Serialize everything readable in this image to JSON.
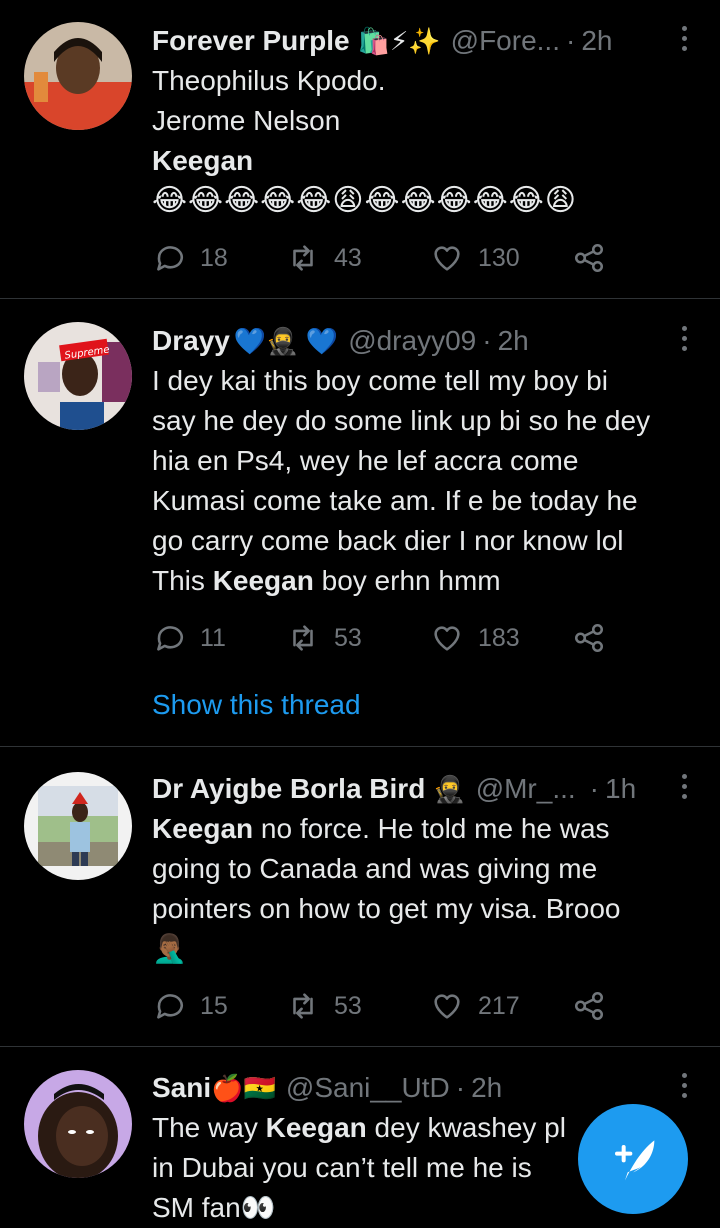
{
  "tweets": [
    {
      "name": "Forever Purple",
      "name_emojis": "🛍️⚡✨",
      "handle": "@Fore...",
      "time": "2h",
      "text_lines": [
        "Theophilus Kpodo.",
        "Jerome Nelson"
      ],
      "bold_line": "Keegan",
      "emoji_line": "😂😂😂😂😂😩😂😂😂😂😂😩",
      "replies": "18",
      "retweets": "43",
      "likes": "130"
    },
    {
      "name": "Drayy",
      "name_emojis": "💙🥷 💙",
      "handle": "@drayy09",
      "time": "2h",
      "text_lines": [
        "I dey kai this boy come tell my boy bi",
        "say he dey do some link up bi so he dey",
        "hia en Ps4, wey he lef accra come",
        "Kumasi come take am. If e be today he",
        "go carry come back dier I nor know lol"
      ],
      "last_prefix": "This ",
      "last_bold": "Keegan",
      "last_suffix": " boy erhn hmm",
      "replies": "11",
      "retweets": "53",
      "likes": "183",
      "show_thread": "Show this thread"
    },
    {
      "name": "Dr Ayigbe Borla Bird",
      "name_emojis": "🥷",
      "handle": "@Mr_...",
      "time": "1h",
      "first_bold": "Keegan",
      "first_rest": " no force. He told me he was",
      "text_lines": [
        "going to Canada and was giving me",
        "pointers on how to get my visa. Brooo"
      ],
      "emoji_line": "🤦🏾‍♂️",
      "replies": "15",
      "retweets": "53",
      "likes": "217"
    },
    {
      "name": "Sani",
      "name_emojis": "🍎🇬🇭",
      "handle": "@Sani__UtD",
      "time": "2h",
      "line1_prefix": "The way ",
      "line1_bold": "Keegan",
      "line1_suffix": " dey kwashey pl",
      "line2": "in Dubai you can’t tell me he is ",
      "line3": "SM fan👀"
    }
  ],
  "compose_button": "compose-tweet"
}
